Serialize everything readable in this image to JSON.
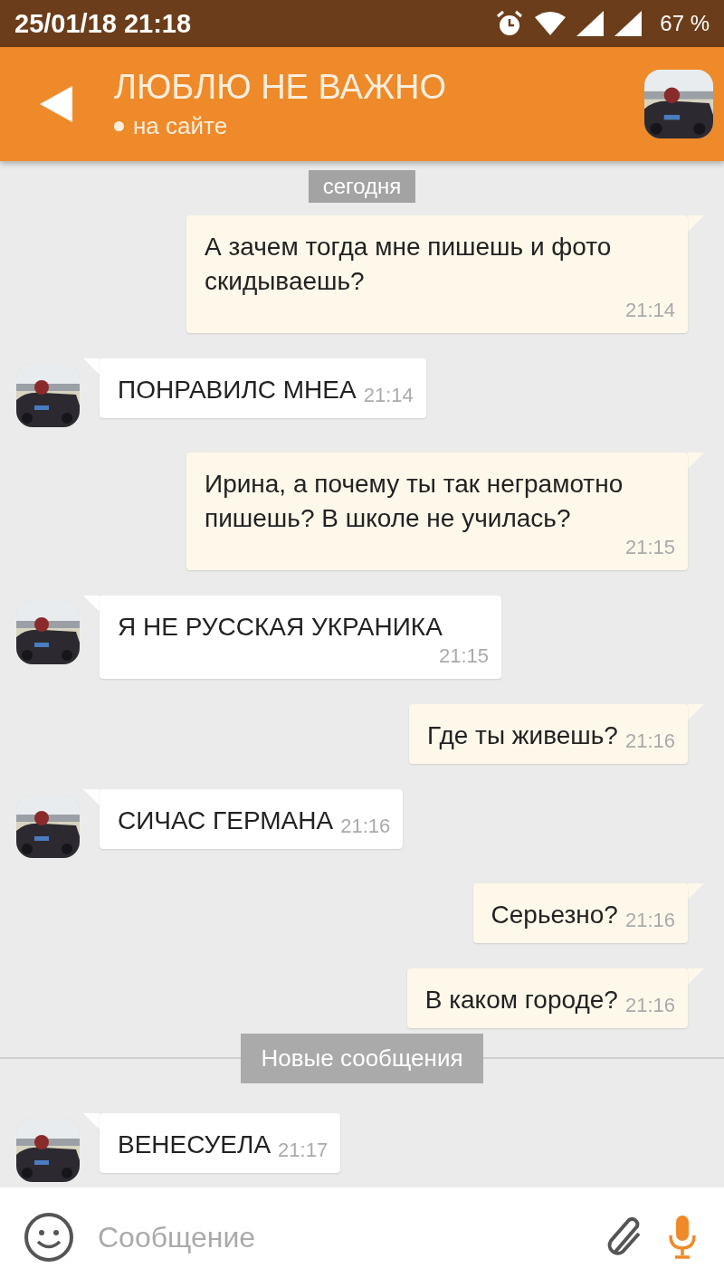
{
  "status_bar": {
    "datetime": "25/01/18 21:18",
    "battery": "67 %"
  },
  "header": {
    "title": "ЛЮБЛЮ НЕ ВАЖНО",
    "status": "на сайте",
    "online": true
  },
  "date_chip": "сегодня",
  "messages": [
    {
      "kind": "out",
      "text": "А зачем тогда мне пишешь и фото скидываешь?",
      "time": "21:14"
    },
    {
      "kind": "in",
      "text": "ПОНРАВИЛС МНЕА",
      "time": "21:14"
    },
    {
      "kind": "out",
      "text": "Ирина, а почему ты так неграмотно пишешь? В школе не училась?",
      "time": "21:15"
    },
    {
      "kind": "in",
      "text": "Я НЕ РУССКАЯ УКРАНИКА",
      "time": "21:15"
    },
    {
      "kind": "out",
      "text": "Где ты живешь?",
      "time": "21:16"
    },
    {
      "kind": "in",
      "text": "СИЧАС ГЕРМАНА",
      "time": "21:16"
    },
    {
      "kind": "out",
      "text": "Серьезно?",
      "time": "21:16"
    },
    {
      "kind": "out",
      "text": "В каком городе?",
      "time": "21:16"
    },
    {
      "kind": "divider",
      "text": "Новые сообщения"
    },
    {
      "kind": "in",
      "text": "ВЕНЕСУЕЛА",
      "time": "21:17"
    }
  ],
  "composer": {
    "placeholder": "Сообщение"
  }
}
